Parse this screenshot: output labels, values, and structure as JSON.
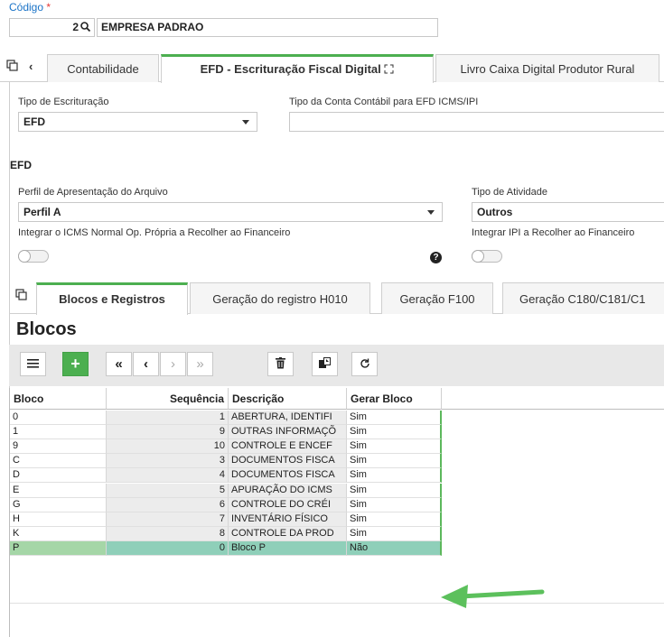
{
  "header": {
    "codigo_label": "Código",
    "required_mark": "*",
    "code_number": "2",
    "company_name": "EMPRESA PADRAO"
  },
  "main_tabs": [
    {
      "label": "Contabilidade"
    },
    {
      "label": "EFD - Escrituração Fiscal Digital",
      "active": true
    },
    {
      "label": "Livro Caixa Digital Produtor Rural"
    }
  ],
  "form": {
    "tipo_escrituracao_label": "Tipo de Escrituração",
    "tipo_escrituracao_value": "EFD",
    "tipo_conta_label": "Tipo da Conta Contábil para EFD ICMS/IPI",
    "tipo_conta_value": "",
    "section_efd": "EFD",
    "perfil_label": "Perfil de Apresentação do Arquivo",
    "perfil_value": "Perfil A",
    "tipo_atividade_label": "Tipo de Atividade",
    "tipo_atividade_value": "Outros",
    "integrar_icms_label": "Integrar o ICMS Normal Op. Própria a Recolher ao Financeiro",
    "integrar_icms_on": false,
    "integrar_ipi_label": "Integrar IPI a Recolher ao Financeiro",
    "integrar_ipi_on": false,
    "help_glyph": "?"
  },
  "sub_tabs": [
    {
      "label": "Blocos e Registros",
      "active": true
    },
    {
      "label": "Geração do registro H010"
    },
    {
      "label": "Geração F100"
    },
    {
      "label": "Geração C180/C181/C1"
    }
  ],
  "blocos": {
    "title": "Blocos",
    "columns": [
      "Bloco",
      "Sequência",
      "Descrição",
      "Gerar Bloco"
    ],
    "rows": [
      {
        "bloco": "0",
        "seq": "1",
        "desc": "ABERTURA, IDENTIFI",
        "gerar": "Sim"
      },
      {
        "bloco": "1",
        "seq": "9",
        "desc": "OUTRAS INFORMAÇÕ",
        "gerar": "Sim"
      },
      {
        "bloco": "9",
        "seq": "10",
        "desc": "CONTROLE E ENCEF",
        "gerar": "Sim"
      },
      {
        "bloco": "C",
        "seq": "3",
        "desc": "DOCUMENTOS FISCA",
        "gerar": "Sim"
      },
      {
        "bloco": "D",
        "seq": "4",
        "desc": "DOCUMENTOS FISCA",
        "gerar": "Sim"
      },
      {
        "bloco": "E",
        "seq": "5",
        "desc": "APURAÇÃO DO ICMS",
        "gerar": "Sim"
      },
      {
        "bloco": "G",
        "seq": "6",
        "desc": "CONTROLE DO CRÉI",
        "gerar": "Sim"
      },
      {
        "bloco": "H",
        "seq": "7",
        "desc": "INVENTÁRIO FÍSICO",
        "gerar": "Sim"
      },
      {
        "bloco": "K",
        "seq": "8",
        "desc": "CONTROLE DA PROD",
        "gerar": "Sim"
      },
      {
        "bloco": "P",
        "seq": "0",
        "desc": "Bloco P",
        "gerar": "Não",
        "selected": true
      }
    ]
  },
  "colors": {
    "accent_green": "#4caf50",
    "link_blue": "#1a73c7",
    "selected_row": "#8fcfb9",
    "arrow_green": "#5cc05c"
  }
}
